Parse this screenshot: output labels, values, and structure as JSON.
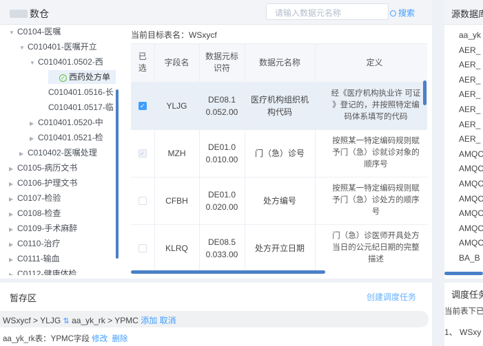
{
  "app": {
    "title": "数仓"
  },
  "search": {
    "placeholder": "请输入数据元名称",
    "button": "搜索"
  },
  "tree": [
    {
      "label": "C0104-医嘱",
      "arrow": "▼"
    },
    {
      "label": "C010401-医嘱开立",
      "arrow": "▼"
    },
    {
      "label": "C010401.0502-西",
      "arrow": "▼"
    },
    {
      "label": "西药处方单",
      "arrow": ""
    },
    {
      "label": "C010401.0516-长",
      "arrow": ""
    },
    {
      "label": "C010401.0517-临",
      "arrow": ""
    },
    {
      "label": "C010401.0520-中",
      "arrow": "▶"
    },
    {
      "label": "C010401.0521-检",
      "arrow": "▶"
    },
    {
      "label": "C010402-医嘱处理",
      "arrow": "▶"
    },
    {
      "label": "C0105-病历文书",
      "arrow": "▶"
    },
    {
      "label": "C0106-护理文书",
      "arrow": "▶"
    },
    {
      "label": "C0107-检验",
      "arrow": "▶"
    },
    {
      "label": "C0108-检查",
      "arrow": "▶"
    },
    {
      "label": "C0109-手术麻醉",
      "arrow": "▶"
    },
    {
      "label": "C0110-治疗",
      "arrow": "▶"
    },
    {
      "label": "C0111-输血",
      "arrow": "▶"
    },
    {
      "label": "C0112-健康体检",
      "arrow": "▶"
    }
  ],
  "target": {
    "label": "当前目标表名：WSxycf"
  },
  "table": {
    "headers": {
      "selected": "已选",
      "field": "字段名",
      "code": "数据元标识符",
      "name": "数据元名称",
      "def": "定义"
    },
    "rows": [
      {
        "state": "checked",
        "field": "YLJG",
        "code1": "DE08.1",
        "code2": "0.052.00",
        "name1": "医疗机构组织机",
        "name2": "构代码",
        "def1": "经《医疗机构执业许 可证",
        "def2": "》登记的，并按照特定编",
        "def3": "码体系填写的代码"
      },
      {
        "state": "disabled",
        "field": "MZH",
        "code1": "DE01.0",
        "code2": "0.010.00",
        "name1": "门（急）诊号",
        "name2": "",
        "def1": "按照某一特定编码规则赋",
        "def2": "予门（急）诊就诊对象的",
        "def3": "顺序号"
      },
      {
        "state": "none",
        "field": "CFBH",
        "code1": "DE01.0",
        "code2": "0.020.00",
        "name1": "处方编号",
        "name2": "",
        "def1": "按照某一特定编码规则赋",
        "def2": "予门（急）诊处方的顺序",
        "def3": "号"
      },
      {
        "state": "none",
        "field": "KLRQ",
        "code1": "DE08.5",
        "code2": "0.033.00",
        "name1": "处方开立日期",
        "name2": "",
        "def1": "门（急）诊医师开具处方",
        "def2": "当日的公元纪日期的完整",
        "def3": "描述"
      }
    ]
  },
  "staging": {
    "title": "暂存区",
    "create_task": "创建调度任务",
    "path_target": "WSxycf",
    "path_field": "YLJG",
    "path_source": "aa_yk_rk",
    "path_source_field": "YPMC",
    "add": "添加",
    "cancel": "取消",
    "field_line_prefix": "aa_yk_rk表：YPMC字段",
    "edit": "修改",
    "delete": "删除"
  },
  "right": {
    "title": "源数据库",
    "items": [
      "aa_yk",
      "AER_",
      "AER_",
      "AER_",
      "AER_",
      "AER_",
      "AER_",
      "AER_",
      "AMQC",
      "AMQC",
      "AMQC",
      "AMQC",
      "AMQC",
      "AMQC",
      "AMQC",
      "BA_B"
    ],
    "sched_title": "调度任务",
    "sched_sub": "当前表下已",
    "sched_item": "1、 WSxy"
  },
  "colors": {
    "accent": "#409eff",
    "scrollbar": "#4a80c8",
    "selected_row": "#e9eff7"
  }
}
